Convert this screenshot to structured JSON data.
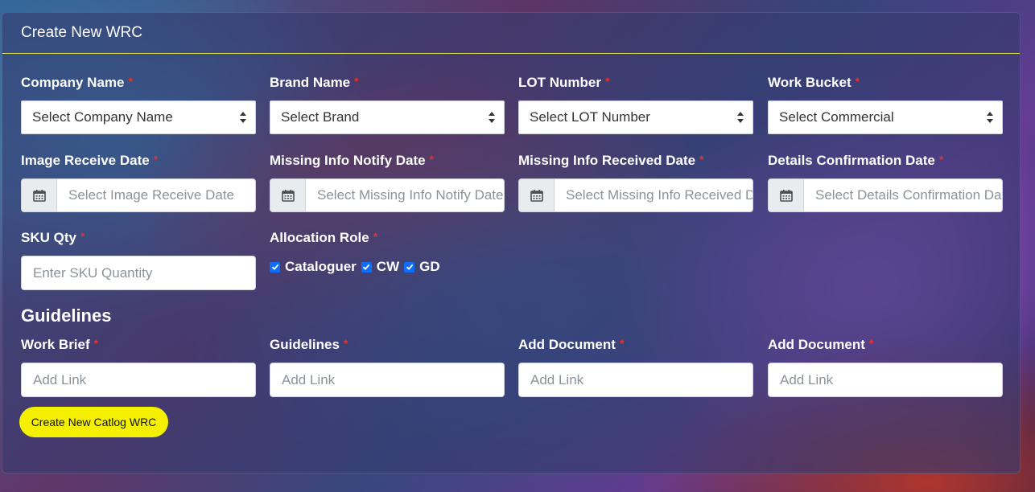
{
  "header": {
    "title": "Create New WRC"
  },
  "fields": {
    "company": {
      "label": "Company Name",
      "value": "Select Company Name"
    },
    "brand": {
      "label": "Brand Name",
      "value": "Select Brand"
    },
    "lot": {
      "label": "LOT Number",
      "value": "Select LOT Number"
    },
    "bucket": {
      "label": "Work Bucket",
      "value": "Select Commercial"
    },
    "image_date": {
      "label": "Image Receive Date",
      "placeholder": "Select Image Receive Date"
    },
    "notify_date": {
      "label": "Missing Info Notify Date",
      "placeholder": "Select Missing Info Notify Date"
    },
    "received_date": {
      "label": "Missing Info Received Date",
      "placeholder": "Select Missing Info Received Date"
    },
    "confirm_date": {
      "label": "Details Confirmation Date",
      "placeholder": "Select Details Confirmation Date"
    },
    "sku": {
      "label": "SKU Qty",
      "placeholder": "Enter SKU Quantity"
    },
    "allocation": {
      "label": "Allocation Role",
      "options": [
        {
          "label": "Cataloguer",
          "checked": true
        },
        {
          "label": "CW",
          "checked": true
        },
        {
          "label": "GD",
          "checked": true
        }
      ]
    }
  },
  "guidelines_section": {
    "title": "Guidelines",
    "work_brief": {
      "label": "Work Brief",
      "placeholder": "Add Link"
    },
    "guidelines": {
      "label": "Guidelines",
      "placeholder": "Add Link"
    },
    "add_document_1": {
      "label": "Add Document",
      "placeholder": "Add Link"
    },
    "add_document_2": {
      "label": "Add Document",
      "placeholder": "Add Link"
    }
  },
  "required_mark": "*",
  "submit": {
    "label": "Create New Catlog WRC"
  },
  "colors": {
    "accent": "#f4f000",
    "required": "#e3342f",
    "checkbox": "#0d6efd"
  },
  "icons": {
    "date_addon": "calendar-icon",
    "select_arrows": "sort-arrows-icon"
  }
}
